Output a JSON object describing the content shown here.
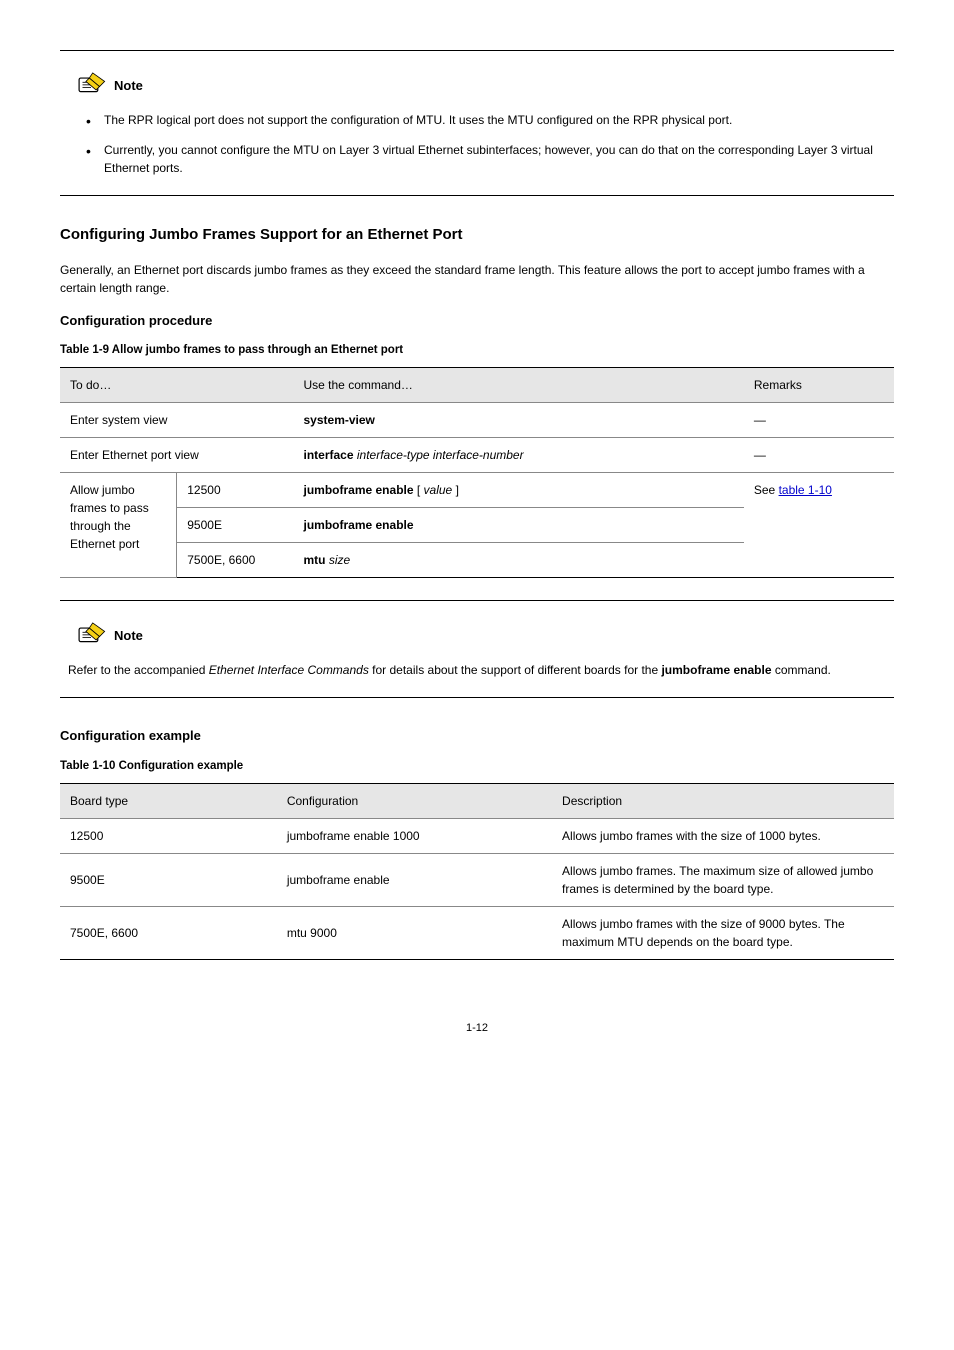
{
  "note1": {
    "label": "Note",
    "bullets": [
      "The RPR logical port does not support the configuration of MTU. It uses the MTU configured on the RPR physical port.",
      "Currently, you cannot configure the MTU on Layer 3 virtual Ethernet subinterfaces; however, you can do that on the corresponding Layer 3 virtual Ethernet ports."
    ]
  },
  "section1": {
    "title": "Configuring Jumbo Frames Support for an Ethernet Port",
    "body": "Generally, an Ethernet port discards jumbo frames as they exceed the standard frame length. This feature allows the port to accept jumbo frames with a certain length range.",
    "subtitle": "Configuration procedure",
    "caption_label": "Table 1-9",
    "caption_text": " Allow jumbo frames to pass through an Ethernet port"
  },
  "table1": {
    "headers": [
      "To do…",
      "Use the command…",
      "Remarks"
    ],
    "rows": [
      {
        "todo": "Enter system view",
        "cmd": "system-view",
        "remarks": "—"
      },
      {
        "todo": "Enter Ethernet port view",
        "cmd_prefix": "interface ",
        "cmd_arg": "interface-type interface-number",
        "remarks": "—"
      }
    ],
    "group": {
      "todo": "Allow jumbo frames to pass through the Ethernet port",
      "items": [
        {
          "board": "12500",
          "cmd_prefix": "jumboframe enable ",
          "cmd_arg": "[ value ]"
        },
        {
          "board": "9500E",
          "cmd_prefix": "jumboframe enable"
        },
        {
          "board": "7500E, 6600",
          "cmd_prefix": "mtu ",
          "cmd_arg": "size"
        }
      ],
      "remarks": "See "
    }
  },
  "note2": {
    "label": "Note",
    "text_before": "Refer to the accompanied ",
    "text_italic": "Ethernet Interface Commands",
    "text_after": " for details about the support of different boards for the ",
    "text_bold": "jumboframe enable",
    "text_tail": " command."
  },
  "section2": {
    "title": "Configuration example",
    "caption_label": "Table 1-10",
    "caption_text": " Configuration example",
    "headers": [
      "Board type",
      "Configuration",
      "Description"
    ],
    "rows": [
      {
        "type": "12500",
        "cfg": "jumboframe enable 1000",
        "desc": "Allows jumbo frames with the size of 1000 bytes."
      },
      {
        "type": "9500E",
        "cfg": "jumboframe enable",
        "desc": "Allows jumbo frames. The maximum size of allowed jumbo frames is determined by the board type."
      },
      {
        "type": "7500E, 6600",
        "cfg": "mtu 9000",
        "desc": "Allows jumbo frames with the size of 9000 bytes. The maximum MTU depends on the board type."
      }
    ]
  },
  "page_number": "1-12"
}
